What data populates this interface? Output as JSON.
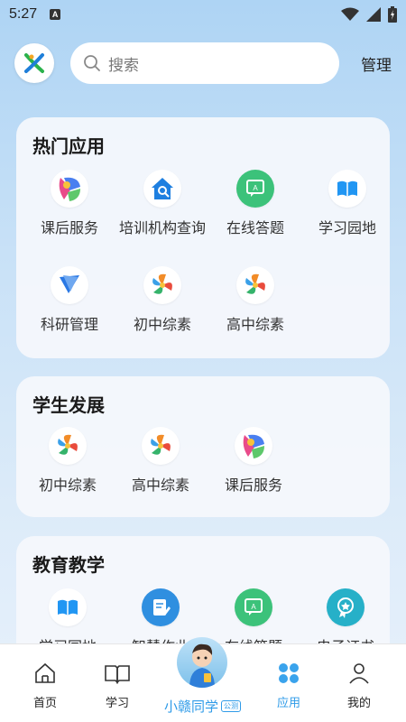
{
  "status_bar": {
    "time": "5:27",
    "notification": "A"
  },
  "header": {
    "search_placeholder": "搜索",
    "manage_label": "管理"
  },
  "sections": [
    {
      "title": "热门应用",
      "apps": [
        "课后服务",
        "培训机构查询",
        "在线答题",
        "学习园地",
        "科研管理",
        "初中综素",
        "高中综素"
      ]
    },
    {
      "title": "学生发展",
      "apps": [
        "初中综素",
        "高中综素",
        "课后服务"
      ]
    },
    {
      "title": "教育教学",
      "apps": [
        "学习园地",
        "智慧作业",
        "在线答题",
        "电子证书"
      ]
    }
  ],
  "bottom_nav": {
    "home": "首页",
    "study": "学习",
    "assistant": "小赣同学",
    "assistant_badge": "公测",
    "apps": "应用",
    "mine": "我的"
  },
  "colors": {
    "accent": "#2f9be8",
    "card_bg": "#f5f8fc"
  },
  "icons": [
    "logo-icon",
    "search-icon",
    "wifi-icon",
    "signal-icon",
    "battery-icon",
    "home-icon",
    "book-icon",
    "apps-icon",
    "user-icon"
  ]
}
